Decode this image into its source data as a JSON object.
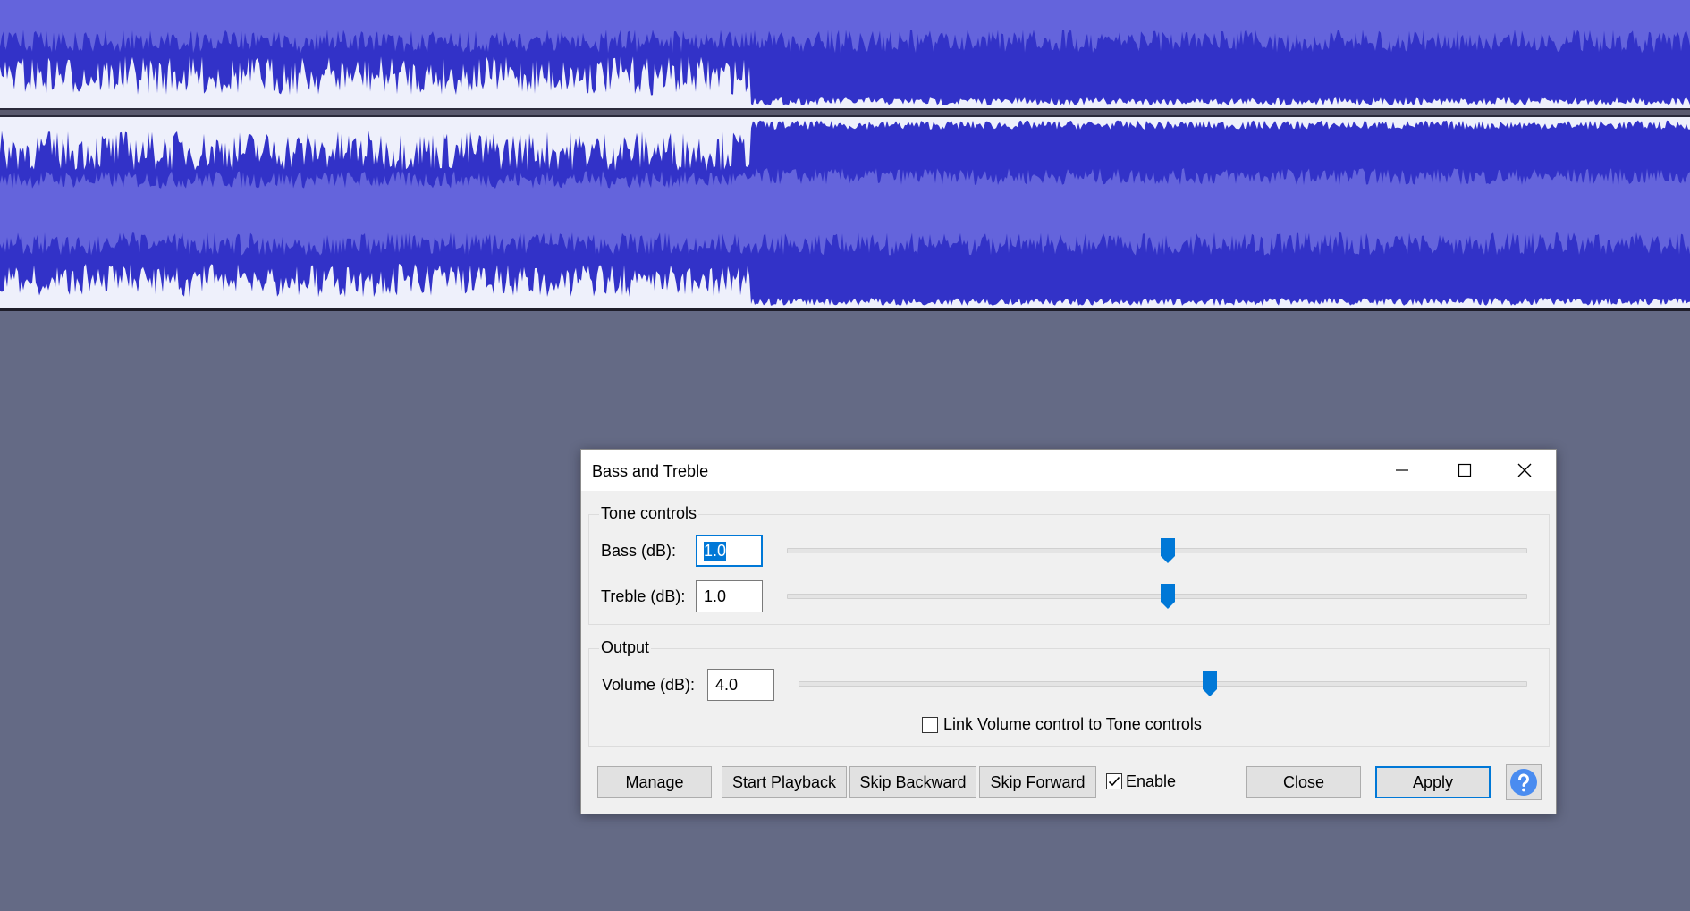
{
  "colors": {
    "workspace": "#646a85",
    "track_bg": "#6464dc",
    "wave_rms": "#3232c8",
    "wave_peak_selected": "#eef0fb",
    "accent": "#0078d7"
  },
  "dialog": {
    "title": "Bass and Treble",
    "window_buttons": [
      "minimize-icon",
      "maximize-icon",
      "close-icon"
    ],
    "tone_controls": {
      "title": "Tone controls",
      "bass": {
        "label": "Bass (dB):",
        "value": "1.0",
        "slider_fraction": 0.515
      },
      "treble": {
        "label": "Treble (dB):",
        "value": "1.0",
        "slider_fraction": 0.515
      }
    },
    "output": {
      "title": "Output",
      "volume": {
        "label": "Volume (dB):",
        "value": "4.0",
        "slider_fraction": 0.565
      },
      "link_checkbox": {
        "label": "Link Volume control to Tone controls",
        "checked": false
      }
    },
    "buttons": {
      "manage": "Manage",
      "start_playback": "Start Playback",
      "skip_backward": "Skip Backward",
      "skip_forward": "Skip Forward",
      "enable": {
        "label": "Enable",
        "checked": true
      },
      "close": "Close",
      "apply": "Apply",
      "help_icon": "question-icon"
    }
  }
}
